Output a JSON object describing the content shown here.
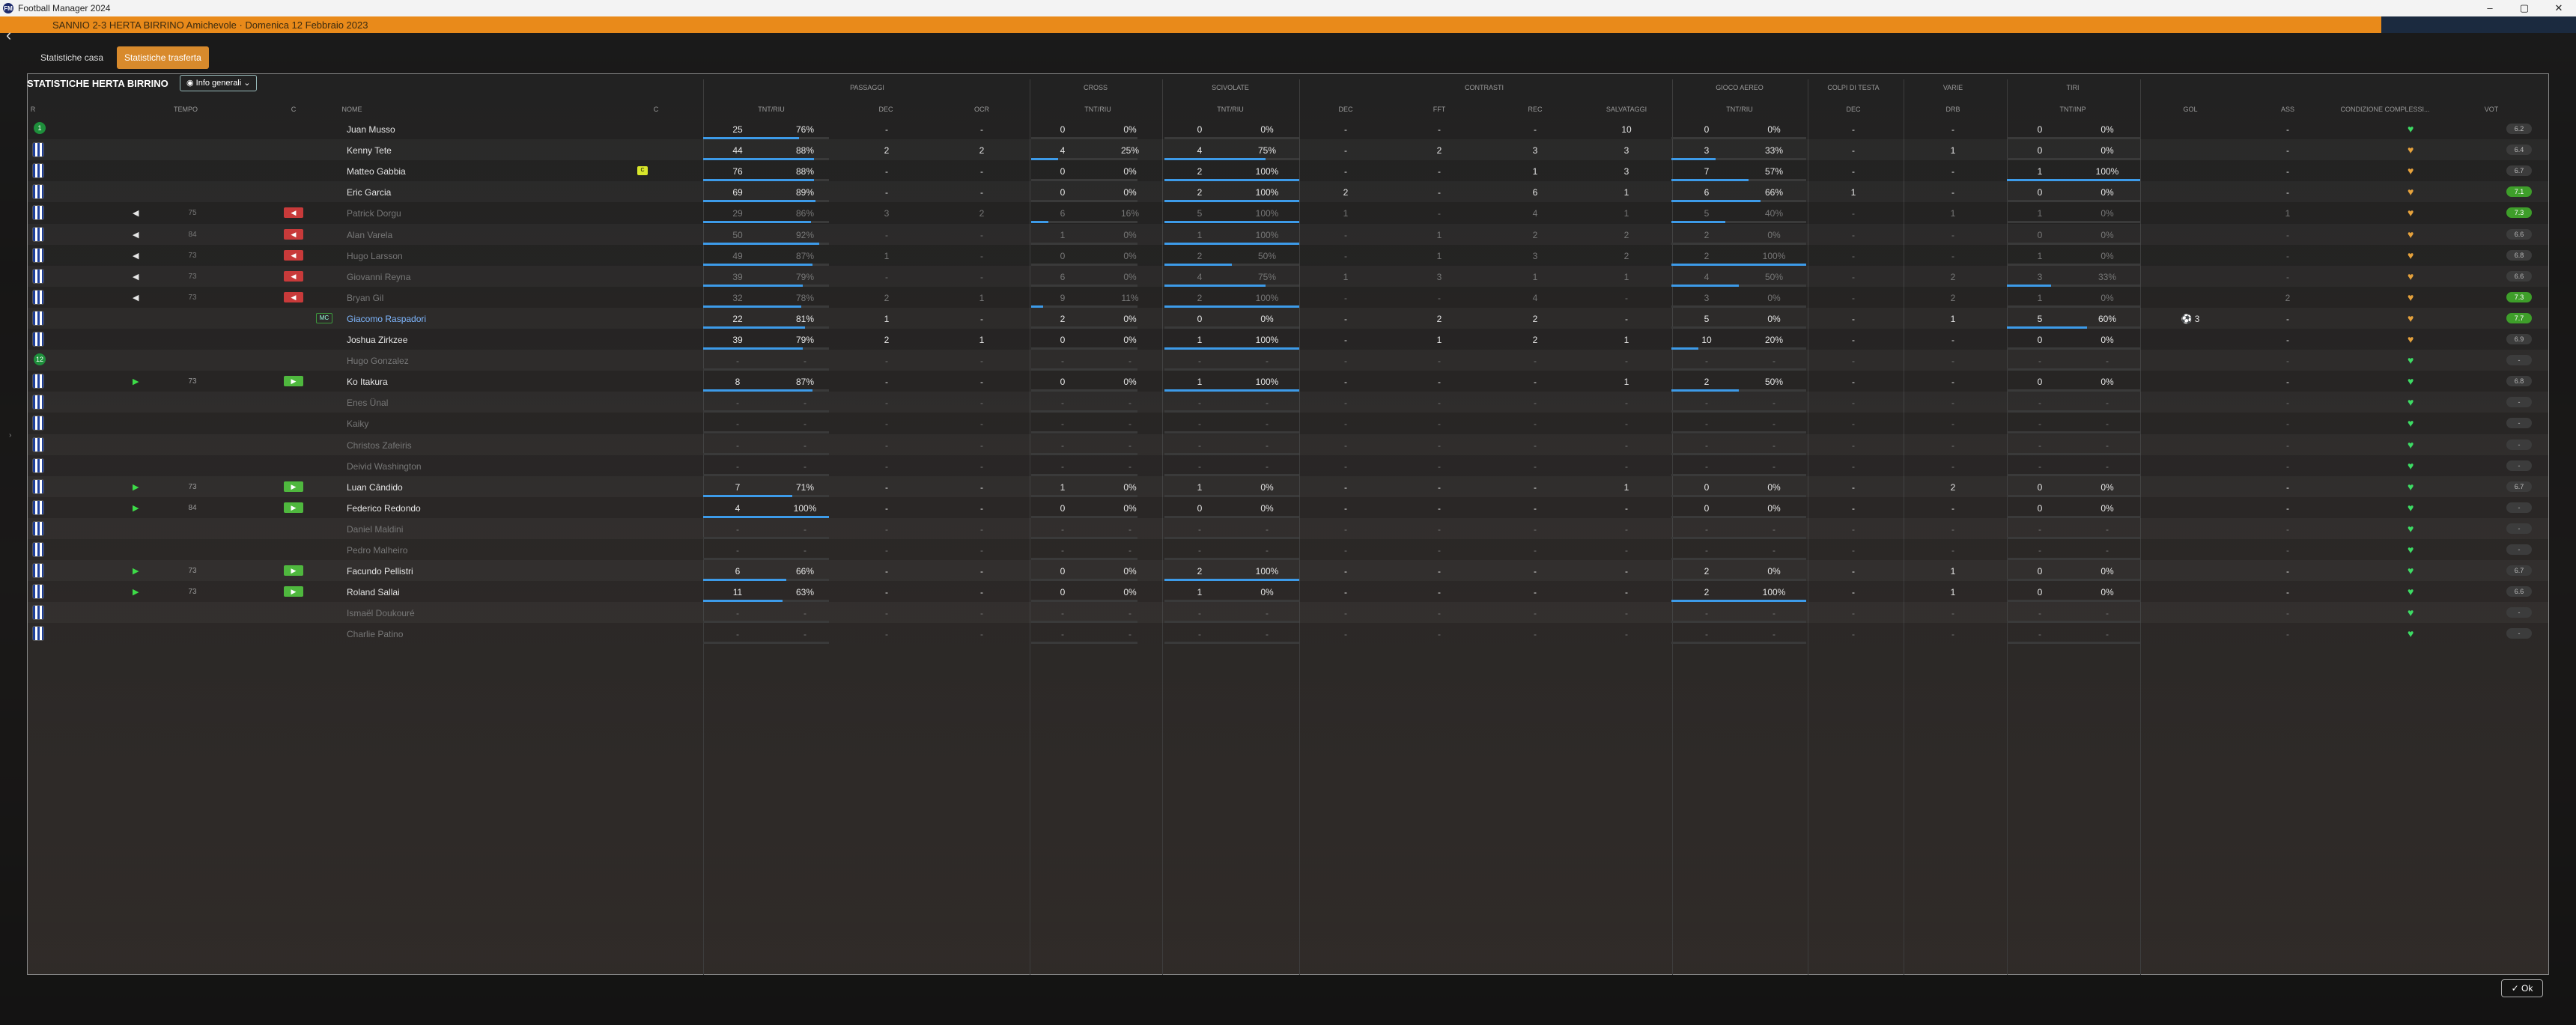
{
  "window": {
    "title": "Football Manager 2024",
    "icon": "FM",
    "controls": [
      "–",
      "▢",
      "✕"
    ]
  },
  "topbar": {
    "match_text": "SANNIO 2-3 HERTA BIRRINO  Amichevole · Domenica 12 Febbraio 2023"
  },
  "tabs": [
    {
      "label": "Statistiche casa",
      "active": false
    },
    {
      "label": "Statistiche trasferta",
      "active": true
    }
  ],
  "panel": {
    "title": "STATISTICHE HERTA BIRRINO",
    "view_label": "Info generali"
  },
  "groups": [
    "PASSAGGI",
    "CROSS",
    "SCIVOLATE",
    "CONTRASTI",
    "GIOCO AEREO",
    "COLPI DI TESTA",
    "VARIE",
    "TIRI"
  ],
  "headers": [
    "R",
    "TEMPO",
    "C",
    "NOME",
    "C",
    "TNT/RIU",
    "DEC",
    "OCR",
    "TNT/RIU",
    "TNT/RIU",
    "DEC",
    "FFT",
    "REC",
    "SALVATAGGI",
    "TNT/RIU",
    "DEC",
    "DRB",
    "TNT/INP",
    "GOL",
    "ASS",
    "CONDIZIONE COMPLESSI...",
    "VOT"
  ],
  "ok_label": "Ok",
  "players": [
    {
      "kit": "gk",
      "pos": "1",
      "time": "",
      "ev": "",
      "name": "Juan Musso",
      "pas": "25",
      "pasp": "76%",
      "pasf": 76,
      "dec": "-",
      "ocr": "-",
      "cr": "0",
      "crp": "0%",
      "crf": 0,
      "sc": "0",
      "scp": "0%",
      "scf": 0,
      "cdec": "-",
      "fft": "-",
      "rec": "-",
      "salv": "10",
      "ga": "0",
      "gap": "0%",
      "gaf": 0,
      "ct": "-",
      "drb": "-",
      "ti": "0",
      "tip": "0%",
      "tif": 0,
      "gol": "",
      "ass": "-",
      "heart": "g",
      "vot": "6.2",
      "votg": false,
      "dim": false
    },
    {
      "name": "Kenny Tete",
      "pas": "44",
      "pasp": "88%",
      "pasf": 88,
      "dec": "2",
      "ocr": "2",
      "cr": "4",
      "crp": "25%",
      "crf": 25,
      "sc": "4",
      "scp": "75%",
      "scf": 75,
      "cdec": "-",
      "fft": "2",
      "rec": "3",
      "salv": "3",
      "ga": "3",
      "gap": "33%",
      "gaf": 33,
      "ct": "-",
      "drb": "1",
      "ti": "0",
      "tip": "0%",
      "tif": 0,
      "ass": "-",
      "heart": "o",
      "vot": "6.4"
    },
    {
      "name": "Matteo Gabbia",
      "yc": true,
      "pas": "76",
      "pasp": "88%",
      "pasf": 88,
      "dec": "-",
      "ocr": "-",
      "cr": "0",
      "crp": "0%",
      "crf": 0,
      "sc": "2",
      "scp": "100%",
      "scf": 100,
      "cdec": "-",
      "fft": "-",
      "rec": "1",
      "salv": "3",
      "ga": "7",
      "gap": "57%",
      "gaf": 57,
      "ct": "-",
      "drb": "-",
      "ti": "1",
      "tip": "100%",
      "tif": 100,
      "ass": "-",
      "heart": "o",
      "vot": "6.7"
    },
    {
      "name": "Eric Garcia",
      "pas": "69",
      "pasp": "89%",
      "pasf": 89,
      "dec": "-",
      "ocr": "-",
      "cr": "0",
      "crp": "0%",
      "crf": 0,
      "sc": "2",
      "scp": "100%",
      "scf": 100,
      "cdec": "2",
      "fft": "-",
      "rec": "6",
      "salv": "1",
      "ga": "6",
      "gap": "66%",
      "gaf": 66,
      "ct": "1",
      "drb": "-",
      "ti": "0",
      "tip": "0%",
      "tif": 0,
      "ass": "-",
      "heart": "o",
      "vot": "7.1",
      "votg": true
    },
    {
      "name": "Patrick Dorgu",
      "time": "75",
      "out": true,
      "ev": "red",
      "pas": "29",
      "pasp": "86%",
      "pasf": 86,
      "dec": "3",
      "ocr": "2",
      "cr": "6",
      "crp": "16%",
      "crf": 16,
      "sc": "5",
      "scp": "100%",
      "scf": 100,
      "cdec": "1",
      "fft": "-",
      "rec": "4",
      "salv": "1",
      "ga": "5",
      "gap": "40%",
      "gaf": 40,
      "ct": "-",
      "drb": "1",
      "ti": "1",
      "tip": "0%",
      "tif": 0,
      "ass": "1",
      "heart": "o",
      "vot": "7.3",
      "votg": true,
      "dim": true
    },
    {
      "name": "Alan Varela",
      "time": "84",
      "out": true,
      "ev": "red",
      "pas": "50",
      "pasp": "92%",
      "pasf": 92,
      "dec": "-",
      "ocr": "-",
      "cr": "1",
      "crp": "0%",
      "crf": 0,
      "sc": "1",
      "scp": "100%",
      "scf": 100,
      "cdec": "-",
      "fft": "1",
      "rec": "2",
      "salv": "2",
      "ga": "2",
      "gap": "0%",
      "gaf": 0,
      "ct": "-",
      "drb": "-",
      "ti": "0",
      "tip": "0%",
      "tif": 0,
      "ass": "-",
      "heart": "o",
      "vot": "6.6",
      "dim": true
    },
    {
      "name": "Hugo Larsson",
      "time": "73",
      "out": true,
      "ev": "red",
      "pas": "49",
      "pasp": "87%",
      "pasf": 87,
      "dec": "1",
      "ocr": "-",
      "cr": "0",
      "crp": "0%",
      "crf": 0,
      "sc": "2",
      "scp": "50%",
      "scf": 50,
      "cdec": "-",
      "fft": "1",
      "rec": "3",
      "salv": "2",
      "ga": "2",
      "gap": "100%",
      "gaf": 100,
      "ct": "-",
      "drb": "-",
      "ti": "1",
      "tip": "0%",
      "tif": 0,
      "ass": "-",
      "heart": "o",
      "vot": "6.8",
      "dim": true
    },
    {
      "name": "Giovanni Reyna",
      "time": "73",
      "out": true,
      "ev": "red",
      "pas": "39",
      "pasp": "79%",
      "pasf": 79,
      "dec": "-",
      "ocr": "-",
      "cr": "6",
      "crp": "0%",
      "crf": 0,
      "sc": "4",
      "scp": "75%",
      "scf": 75,
      "cdec": "1",
      "fft": "3",
      "rec": "1",
      "salv": "1",
      "ga": "4",
      "gap": "50%",
      "gaf": 50,
      "ct": "-",
      "drb": "2",
      "ti": "3",
      "tip": "33%",
      "tif": 33,
      "ass": "-",
      "heart": "o",
      "vot": "6.6",
      "dim": true
    },
    {
      "name": "Bryan Gil",
      "time": "73",
      "out": true,
      "ev": "red",
      "pas": "32",
      "pasp": "78%",
      "pasf": 78,
      "dec": "2",
      "ocr": "1",
      "cr": "9",
      "crp": "11%",
      "crf": 11,
      "sc": "2",
      "scp": "100%",
      "scf": 100,
      "cdec": "-",
      "fft": "-",
      "rec": "4",
      "salv": "-",
      "ga": "3",
      "gap": "0%",
      "gaf": 0,
      "ct": "-",
      "drb": "2",
      "ti": "1",
      "tip": "0%",
      "tif": 0,
      "ass": "2",
      "heart": "o",
      "vot": "7.3",
      "votg": true,
      "dim": true
    },
    {
      "name": "Giacomo Raspadori",
      "blue": true,
      "mc": true,
      "pas": "22",
      "pasp": "81%",
      "pasf": 81,
      "dec": "1",
      "ocr": "-",
      "cr": "2",
      "crp": "0%",
      "crf": 0,
      "sc": "0",
      "scp": "0%",
      "scf": 0,
      "cdec": "-",
      "fft": "2",
      "rec": "2",
      "salv": "-",
      "ga": "5",
      "gap": "0%",
      "gaf": 0,
      "ct": "-",
      "drb": "1",
      "ti": "5",
      "tip": "60%",
      "tif": 60,
      "gol": "3",
      "ass": "-",
      "heart": "o",
      "vot": "7.7",
      "votg": true
    },
    {
      "name": "Joshua Zirkzee",
      "pas": "39",
      "pasp": "79%",
      "pasf": 79,
      "dec": "2",
      "ocr": "1",
      "cr": "0",
      "crp": "0%",
      "crf": 0,
      "sc": "1",
      "scp": "100%",
      "scf": 100,
      "cdec": "-",
      "fft": "1",
      "rec": "2",
      "salv": "1",
      "ga": "10",
      "gap": "20%",
      "gaf": 20,
      "ct": "-",
      "drb": "-",
      "ti": "0",
      "tip": "0%",
      "tif": 0,
      "ass": "-",
      "heart": "o",
      "vot": "6.9"
    },
    {
      "pos": "12",
      "name": "Hugo Gonzalez",
      "empty": true,
      "dim": true,
      "heart": "g"
    },
    {
      "name": "Ko Itakura",
      "time": "73",
      "in": true,
      "ev": "grn",
      "pas": "8",
      "pasp": "87%",
      "pasf": 87,
      "dec": "-",
      "ocr": "-",
      "cr": "0",
      "crp": "0%",
      "crf": 0,
      "sc": "1",
      "scp": "100%",
      "scf": 100,
      "cdec": "-",
      "fft": "-",
      "rec": "-",
      "salv": "1",
      "ga": "2",
      "gap": "50%",
      "gaf": 50,
      "ct": "-",
      "drb": "-",
      "ti": "0",
      "tip": "0%",
      "tif": 0,
      "ass": "-",
      "heart": "g",
      "vot": "6.8"
    },
    {
      "name": "Enes Ünal",
      "empty": true,
      "dim": true,
      "heart": "g"
    },
    {
      "name": "Kaiky",
      "empty": true,
      "dim": true,
      "heart": "g"
    },
    {
      "name": "Christos Zafeiris",
      "empty": true,
      "dim": true,
      "heart": "g"
    },
    {
      "name": "Deivid Washington",
      "empty": true,
      "dim": true,
      "heart": "g"
    },
    {
      "name": "Luan Cândido",
      "time": "73",
      "in": true,
      "ev": "grn",
      "pas": "7",
      "pasp": "71%",
      "pasf": 71,
      "dec": "-",
      "ocr": "-",
      "cr": "1",
      "crp": "0%",
      "crf": 0,
      "sc": "1",
      "scp": "0%",
      "scf": 0,
      "cdec": "-",
      "fft": "-",
      "rec": "-",
      "salv": "1",
      "ga": "0",
      "gap": "0%",
      "gaf": 0,
      "ct": "-",
      "drb": "2",
      "ti": "0",
      "tip": "0%",
      "tif": 0,
      "ass": "-",
      "heart": "g",
      "vot": "6.7"
    },
    {
      "name": "Federico Redondo",
      "time": "84",
      "in": true,
      "ev": "grn",
      "pas": "4",
      "pasp": "100%",
      "pasf": 100,
      "dec": "-",
      "ocr": "-",
      "cr": "0",
      "crp": "0%",
      "crf": 0,
      "sc": "0",
      "scp": "0%",
      "scf": 0,
      "cdec": "-",
      "fft": "-",
      "rec": "-",
      "salv": "-",
      "ga": "0",
      "gap": "0%",
      "gaf": 0,
      "ct": "-",
      "drb": "-",
      "ti": "0",
      "tip": "0%",
      "tif": 0,
      "ass": "-",
      "heart": "g",
      "vot": "-"
    },
    {
      "name": "Daniel Maldini",
      "empty": true,
      "dim": true,
      "heart": "g"
    },
    {
      "name": "Pedro Malheiro",
      "empty": true,
      "dim": true,
      "heart": "g"
    },
    {
      "name": "Facundo Pellistri",
      "time": "73",
      "in": true,
      "ev": "grn",
      "pas": "6",
      "pasp": "66%",
      "pasf": 66,
      "dec": "-",
      "ocr": "-",
      "cr": "0",
      "crp": "0%",
      "crf": 0,
      "sc": "2",
      "scp": "100%",
      "scf": 100,
      "cdec": "-",
      "fft": "-",
      "rec": "-",
      "salv": "-",
      "ga": "2",
      "gap": "0%",
      "gaf": 0,
      "ct": "-",
      "drb": "1",
      "ti": "0",
      "tip": "0%",
      "tif": 0,
      "ass": "-",
      "heart": "g",
      "vot": "6.7"
    },
    {
      "name": "Roland Sallai",
      "time": "73",
      "in": true,
      "ev": "grn",
      "pas": "11",
      "pasp": "63%",
      "pasf": 63,
      "dec": "-",
      "ocr": "-",
      "cr": "0",
      "crp": "0%",
      "crf": 0,
      "sc": "1",
      "scp": "0%",
      "scf": 0,
      "cdec": "-",
      "fft": "-",
      "rec": "-",
      "salv": "-",
      "ga": "2",
      "gap": "100%",
      "gaf": 100,
      "ct": "-",
      "drb": "1",
      "ti": "0",
      "tip": "0%",
      "tif": 0,
      "ass": "-",
      "heart": "g",
      "vot": "6.6"
    },
    {
      "name": "Ismaël Doukouré",
      "empty": true,
      "dim": true,
      "heart": "g"
    },
    {
      "name": "Charlie Patino",
      "empty": true,
      "dim": true,
      "heart": "g"
    }
  ]
}
